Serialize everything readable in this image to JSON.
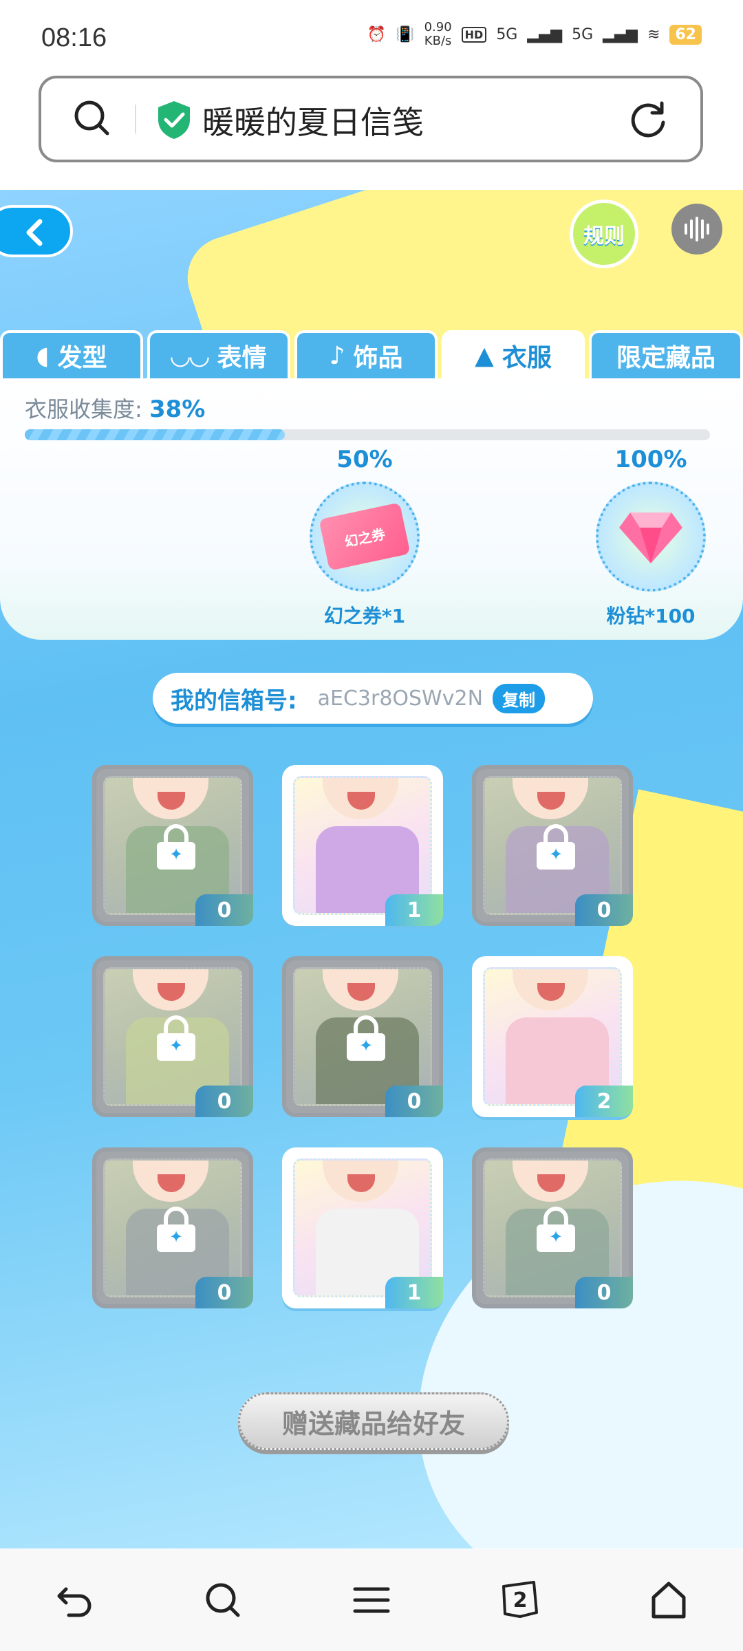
{
  "status_bar": {
    "time": "08:16",
    "network_speed_value": "0.90",
    "network_speed_unit": "KB/s",
    "signal_1": "5G",
    "signal_2": "5G",
    "battery": "62"
  },
  "browser": {
    "page_title": "暖暖的夏日信笺"
  },
  "game": {
    "rules_label": "规则",
    "tabs": [
      {
        "label": "发型"
      },
      {
        "label": "表情"
      },
      {
        "label": "饰品"
      },
      {
        "label": "衣服"
      },
      {
        "label": "限定藏品"
      }
    ],
    "progress": {
      "label": "衣服收集度:",
      "value_text": "38%",
      "value": 0.38
    },
    "milestones": [
      {
        "percent": "50%",
        "reward": "幻之券*1",
        "item_text": "幻之券"
      },
      {
        "percent": "100%",
        "reward": "粉钻*100"
      }
    ],
    "mailbox": {
      "label": "我的信箱号:",
      "code": "aEC3r8OSWv2N",
      "copy_label": "复制"
    },
    "items": [
      {
        "count": "0",
        "locked": true,
        "outfit_color": "#8fb08a"
      },
      {
        "count": "1",
        "locked": false,
        "outfit_color": "#cfa9e6"
      },
      {
        "count": "0",
        "locked": true,
        "outfit_color": "#b6a3c8"
      },
      {
        "count": "0",
        "locked": true,
        "outfit_color": "#c5d39a"
      },
      {
        "count": "0",
        "locked": true,
        "outfit_color": "#6f7d63"
      },
      {
        "count": "2",
        "locked": false,
        "outfit_color": "#f6c7d4"
      },
      {
        "count": "0",
        "locked": true,
        "outfit_color": "#9ea6a8"
      },
      {
        "count": "1",
        "locked": false,
        "outfit_color": "#f2f2f2"
      },
      {
        "count": "0",
        "locked": true,
        "outfit_color": "#8fa89a"
      }
    ],
    "gift_button": "赠送藏品给好友"
  },
  "nav": {
    "tab_count": "2"
  }
}
